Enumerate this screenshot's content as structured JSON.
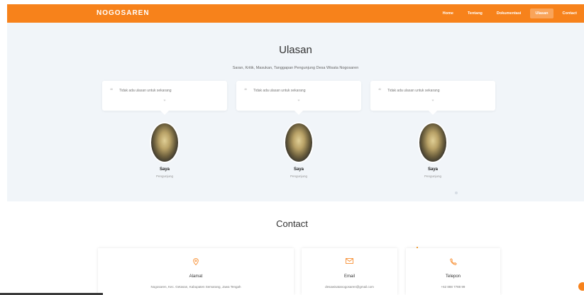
{
  "brand": "NOGOSAREN",
  "nav": [
    {
      "label": "Home",
      "active": false
    },
    {
      "label": "Tentang",
      "active": false
    },
    {
      "label": "Dokumentasi",
      "active": false
    },
    {
      "label": "Ulasan",
      "active": true
    },
    {
      "label": "Contact",
      "active": false
    }
  ],
  "reviews": {
    "title": "Ulasan",
    "subtitle": "Saran, Kritik, Masukan, Tanggapan Pengunjung Desa Wisata Nogosaren",
    "items": [
      {
        "text": "Tidak ada ulasan untuk sekarang",
        "name": "Saya",
        "role": "Pengunjung"
      },
      {
        "text": "Tidak ada ulasan untuk sekarang",
        "name": "Saya",
        "role": "Pengunjung"
      },
      {
        "text": "Tidak ada ulasan untuk sekarang",
        "name": "Saya",
        "role": "Pengunjung"
      }
    ]
  },
  "contact": {
    "title": "Contact",
    "items": [
      {
        "icon": "map-pin-icon",
        "label": "Alamat",
        "value": "Nogosaren, Kec. Getasan, Kabupaten Semarang, Jawa Tengah"
      },
      {
        "icon": "envelope-icon",
        "label": "Email",
        "value": "desawisatanogosaren@gmail.com"
      },
      {
        "icon": "phone-icon",
        "label": "Telepon",
        "value": "+62 888 7788 99"
      }
    ]
  },
  "colors": {
    "accent": "#f7821b",
    "section_bg": "#f1f5f9"
  }
}
